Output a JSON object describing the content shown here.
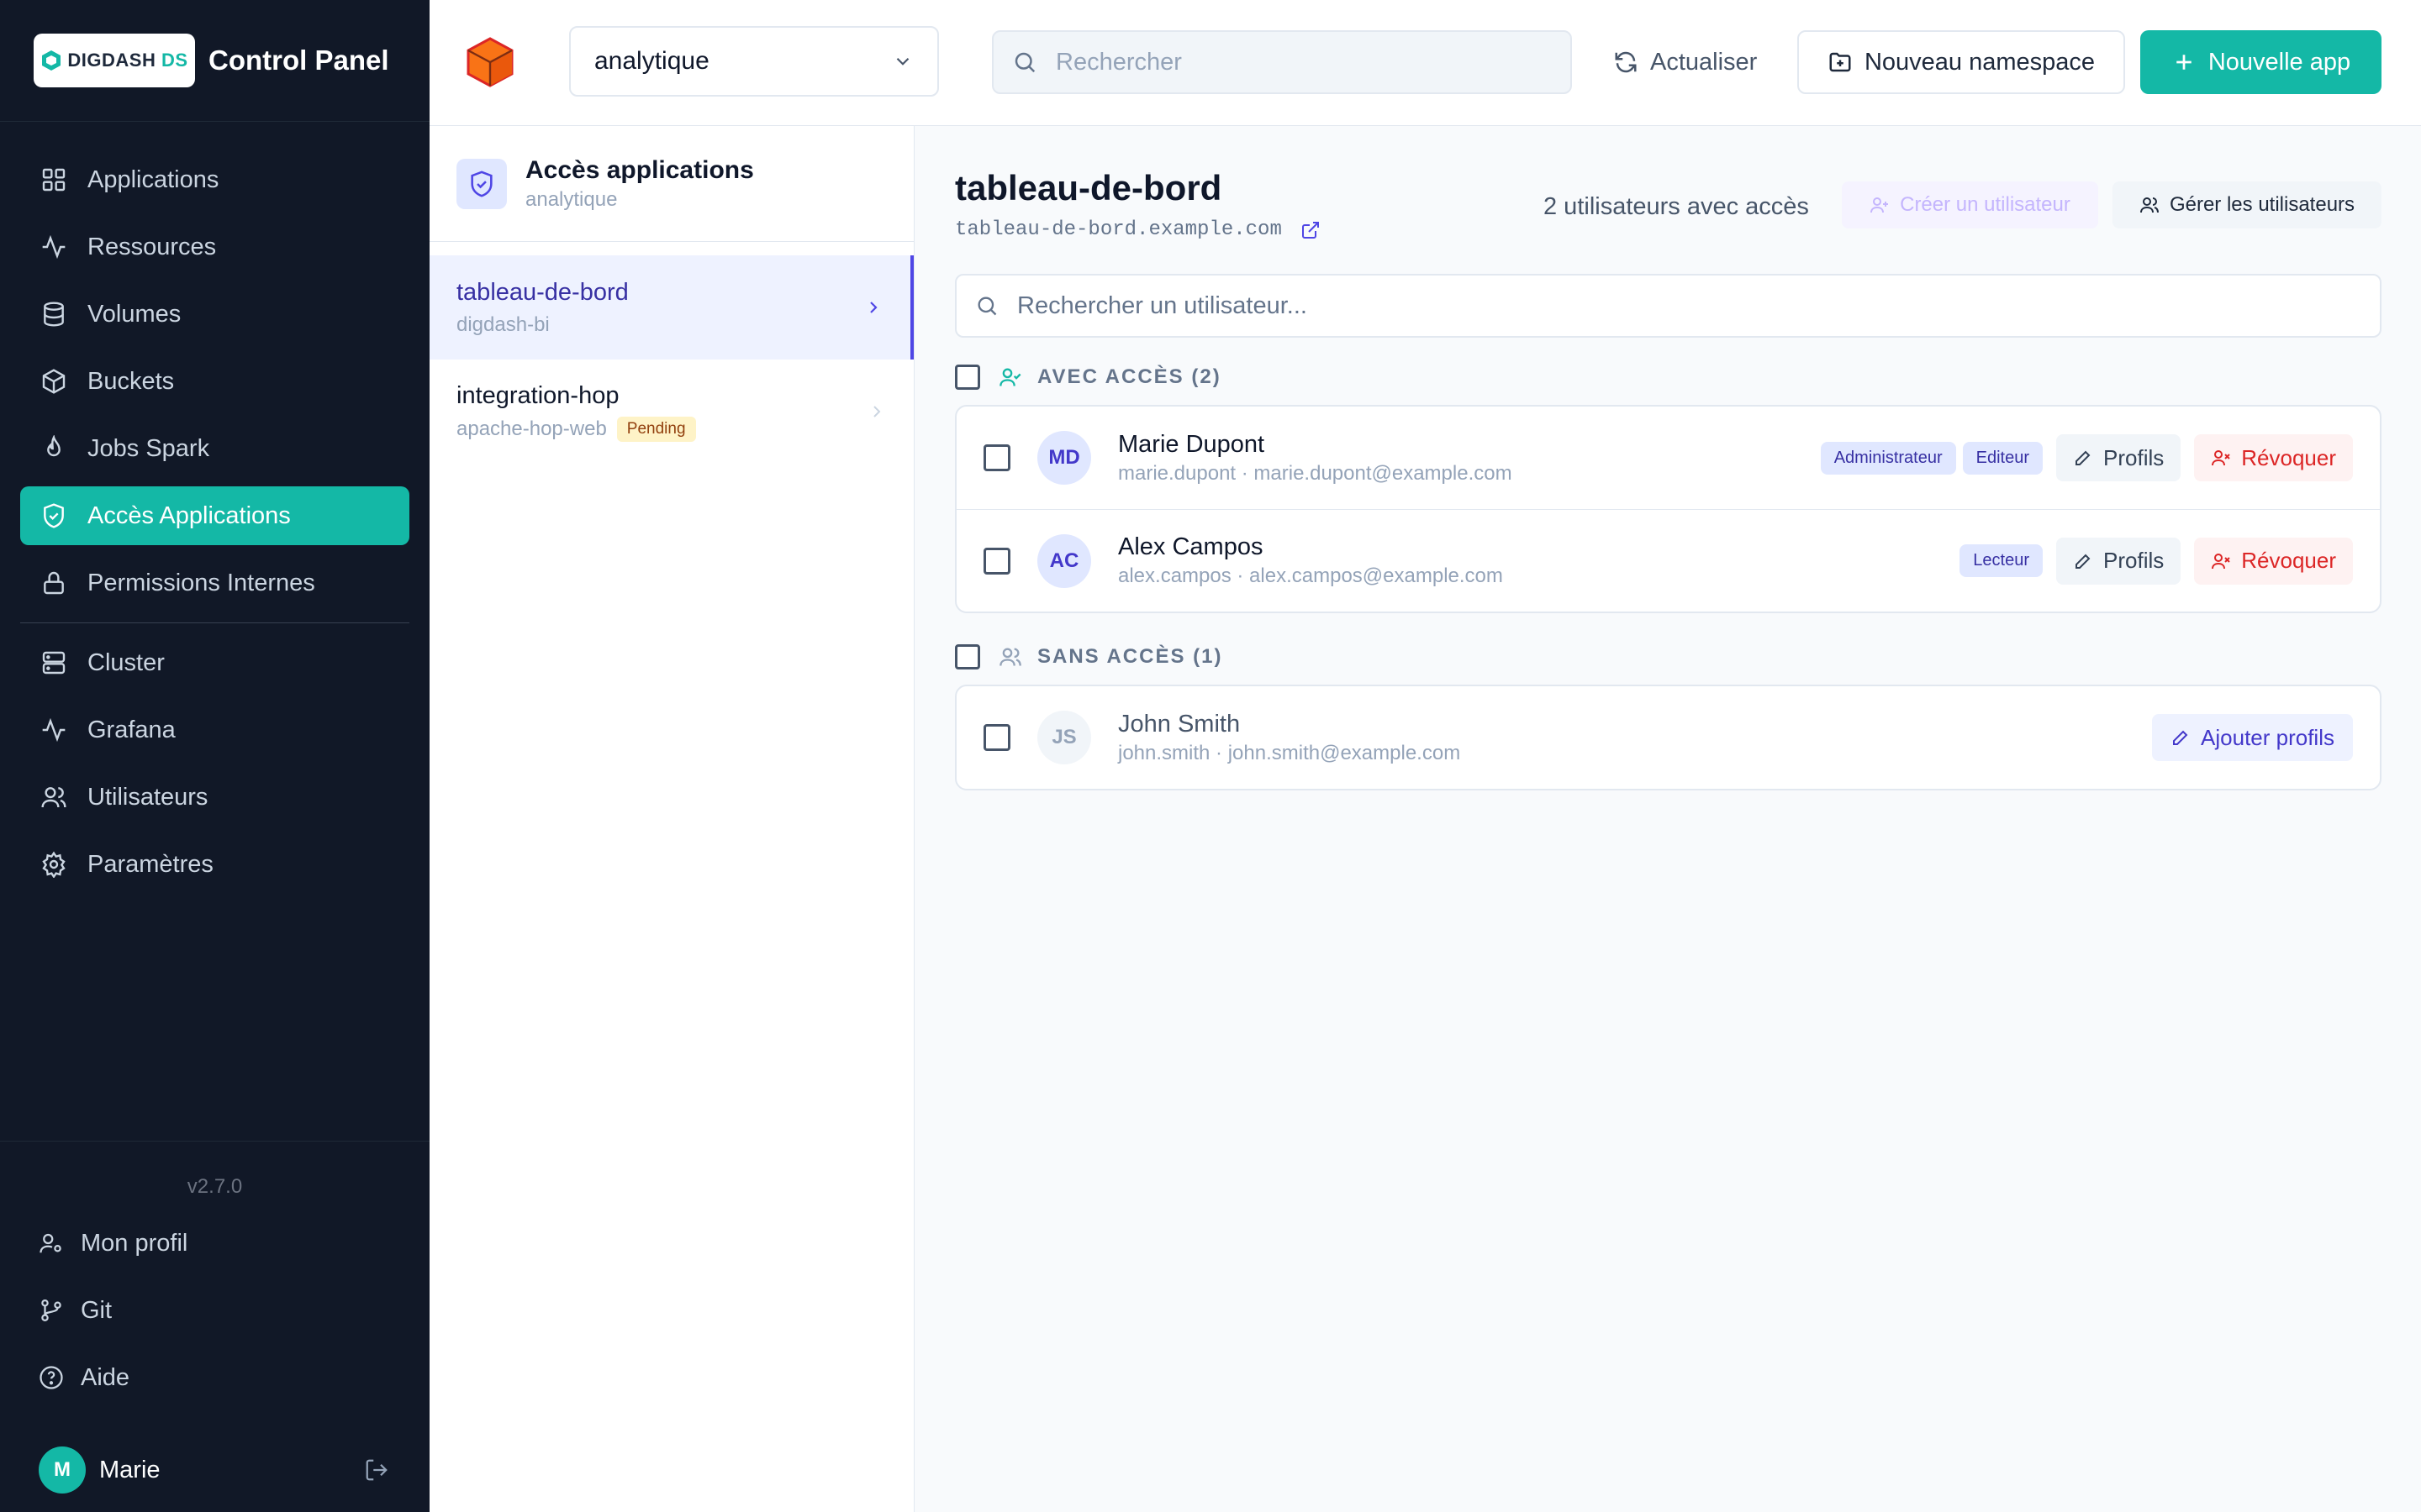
{
  "sidebar": {
    "logo_text": "DIGDASH",
    "logo_suffix": "DS",
    "title": "Control Panel",
    "nav": [
      {
        "label": "Applications",
        "icon": "grid-icon"
      },
      {
        "label": "Ressources",
        "icon": "activity-icon"
      },
      {
        "label": "Volumes",
        "icon": "database-icon"
      },
      {
        "label": "Buckets",
        "icon": "box-icon"
      },
      {
        "label": "Jobs Spark",
        "icon": "flame-icon"
      },
      {
        "label": "Accès Applications",
        "icon": "shield-check-icon",
        "active": true
      },
      {
        "label": "Permissions Internes",
        "icon": "lock-icon"
      },
      {
        "label": "Cluster",
        "icon": "server-icon"
      },
      {
        "label": "Grafana",
        "icon": "activity-icon"
      },
      {
        "label": "Utilisateurs",
        "icon": "users-icon"
      },
      {
        "label": "Paramètres",
        "icon": "gear-icon"
      }
    ],
    "version": "v2.7.0",
    "footer": [
      {
        "label": "Mon profil",
        "icon": "user-cog-icon"
      },
      {
        "label": "Git",
        "icon": "git-branch-icon"
      },
      {
        "label": "Aide",
        "icon": "help-circle-icon"
      }
    ],
    "user": {
      "initial": "M",
      "name": "Marie"
    }
  },
  "topbar": {
    "namespace": "analytique",
    "search_placeholder": "Rechercher",
    "refresh_label": "Actualiser",
    "new_namespace_label": "Nouveau namespace",
    "new_app_label": "Nouvelle app"
  },
  "apps_panel": {
    "title": "Accès applications",
    "subtitle": "analytique",
    "items": [
      {
        "name": "tableau-de-bord",
        "sub": "digdash-bi",
        "selected": true
      },
      {
        "name": "integration-hop",
        "sub": "apache-hop-web",
        "status": "Pending"
      }
    ]
  },
  "detail": {
    "app_name": "tableau-de-bord",
    "url": "tableau-de-bord.example.com",
    "user_count": "2 utilisateurs avec accès",
    "create_user_label": "Créer un utilisateur",
    "manage_users_label": "Gérer les utilisateurs",
    "user_search_placeholder": "Rechercher un utilisateur...",
    "with_access_title": "AVEC ACCÈS (2)",
    "without_access_title": "SANS ACCÈS (1)",
    "profiles_label": "Profils",
    "revoke_label": "Révoquer",
    "add_profiles_label": "Ajouter profils",
    "with_access": [
      {
        "initials": "MD",
        "name": "Marie Dupont",
        "login": "marie.dupont · marie.dupont@example.com",
        "roles": [
          "Administrateur",
          "Editeur"
        ]
      },
      {
        "initials": "AC",
        "name": "Alex Campos",
        "login": "alex.campos · alex.campos@example.com",
        "roles": [
          "Lecteur"
        ]
      }
    ],
    "without_access": [
      {
        "initials": "JS",
        "name": "John Smith",
        "login": "john.smith · john.smith@example.com"
      }
    ]
  },
  "colors": {
    "accent": "#14b8a6",
    "sidebar_bg": "#111827",
    "selection": "#4f46e5",
    "danger": "#dc2626"
  }
}
